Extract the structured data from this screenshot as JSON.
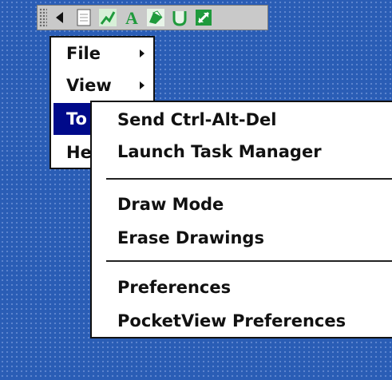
{
  "toolbar": {
    "buttons": [
      {
        "icon": "grip-icon"
      },
      {
        "icon": "left-arrow-icon"
      },
      {
        "icon": "document-icon"
      },
      {
        "icon": "pen-icon"
      },
      {
        "icon": "text-icon",
        "label": "A"
      },
      {
        "icon": "highlighter-icon"
      },
      {
        "icon": "eraser-icon"
      },
      {
        "icon": "fullscreen-icon"
      }
    ],
    "accent_green": "#1f9a3c"
  },
  "main_menu": {
    "items": [
      {
        "label": "File",
        "has_submenu": true
      },
      {
        "label": "View",
        "has_submenu": true
      },
      {
        "label": "Tools",
        "visible_text": "To",
        "has_submenu": true,
        "selected": true
      },
      {
        "label": "Help",
        "visible_text": "He",
        "has_submenu": false
      }
    ],
    "selection_color": "#000a8a"
  },
  "tools_submenu": {
    "groups": [
      [
        {
          "label": "Send Ctrl-Alt-Del"
        },
        {
          "label": "Launch Task Manager"
        }
      ],
      [
        {
          "label": "Draw Mode"
        },
        {
          "label": "Erase Drawings"
        }
      ],
      [
        {
          "label": "Preferences"
        },
        {
          "label": "PocketView Preferences"
        }
      ]
    ]
  },
  "background_color": "#2a5db5"
}
